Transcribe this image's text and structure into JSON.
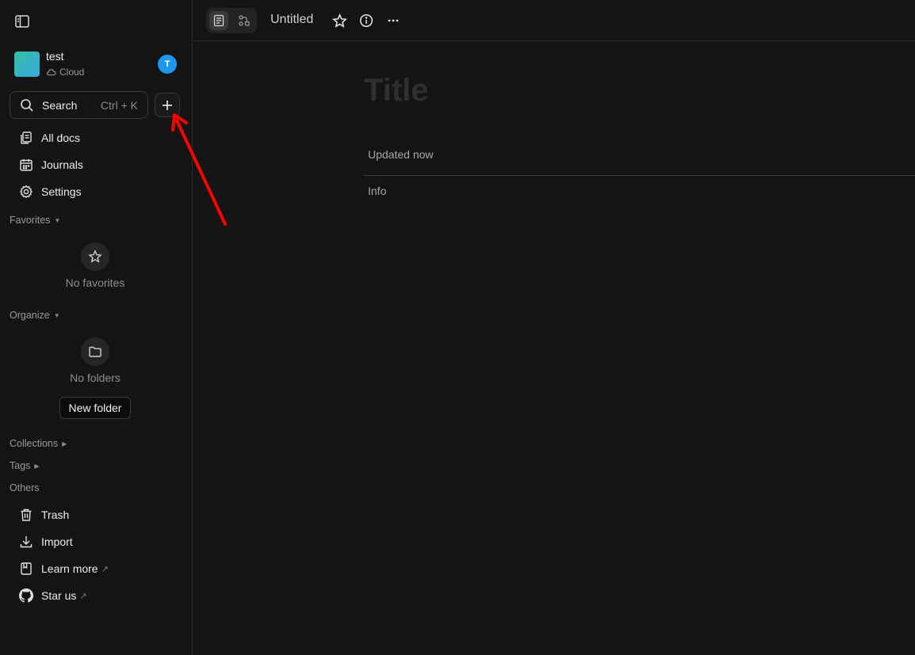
{
  "workspace": {
    "name": "test",
    "type_label": "Cloud",
    "user_initial": "T"
  },
  "search": {
    "label": "Search",
    "shortcut": "Ctrl + K"
  },
  "nav": {
    "all_docs": "All docs",
    "journals": "Journals",
    "settings": "Settings"
  },
  "favorites": {
    "title": "Favorites",
    "empty_text": "No favorites"
  },
  "organize": {
    "title": "Organize",
    "empty_text": "No folders",
    "new_folder_label": "New folder"
  },
  "collections": {
    "title": "Collections"
  },
  "tags": {
    "title": "Tags"
  },
  "others": {
    "title": "Others",
    "trash": "Trash",
    "import": "Import",
    "learn_more": "Learn more",
    "star_us": "Star us"
  },
  "doc": {
    "title": "Untitled",
    "title_placeholder": "Title",
    "updated": "Updated now",
    "info": "Info"
  },
  "colors": {
    "accent_user": "#1e96eb",
    "annotation_arrow": "#ff0000"
  },
  "icons": {
    "sidebar_toggle": "sidebar-toggle-icon",
    "new_doc": "plus-icon",
    "favorite": "star-icon",
    "doc_info": "info-icon",
    "more": "more-horizontal-icon"
  }
}
